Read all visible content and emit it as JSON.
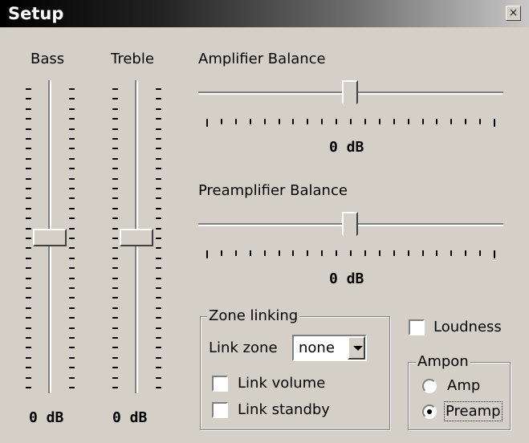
{
  "window": {
    "title": "Setup",
    "close_glyph": "×"
  },
  "bass": {
    "label": "Bass",
    "value_label": "0 dB",
    "level": 0.5
  },
  "treble": {
    "label": "Treble",
    "value_label": "0 dB",
    "level": 0.5
  },
  "amp_balance": {
    "label": "Amplifier Balance",
    "value_label": "0 dB",
    "level": 0.5
  },
  "preamp_balance": {
    "label": "Preamplifier Balance",
    "value_label": "0 dB",
    "level": 0.5
  },
  "zone": {
    "legend": "Zone linking",
    "link_zone_label": "Link zone",
    "link_zone_value": "none",
    "link_volume_label": "Link volume",
    "link_volume_checked": false,
    "link_standby_label": "Link standby",
    "link_standby_checked": false
  },
  "loudness": {
    "label": "Loudness",
    "checked": false
  },
  "ampon": {
    "legend": "Ampon",
    "options": [
      {
        "label": "Amp",
        "selected": false
      },
      {
        "label": "Preamp",
        "selected": true
      }
    ]
  }
}
